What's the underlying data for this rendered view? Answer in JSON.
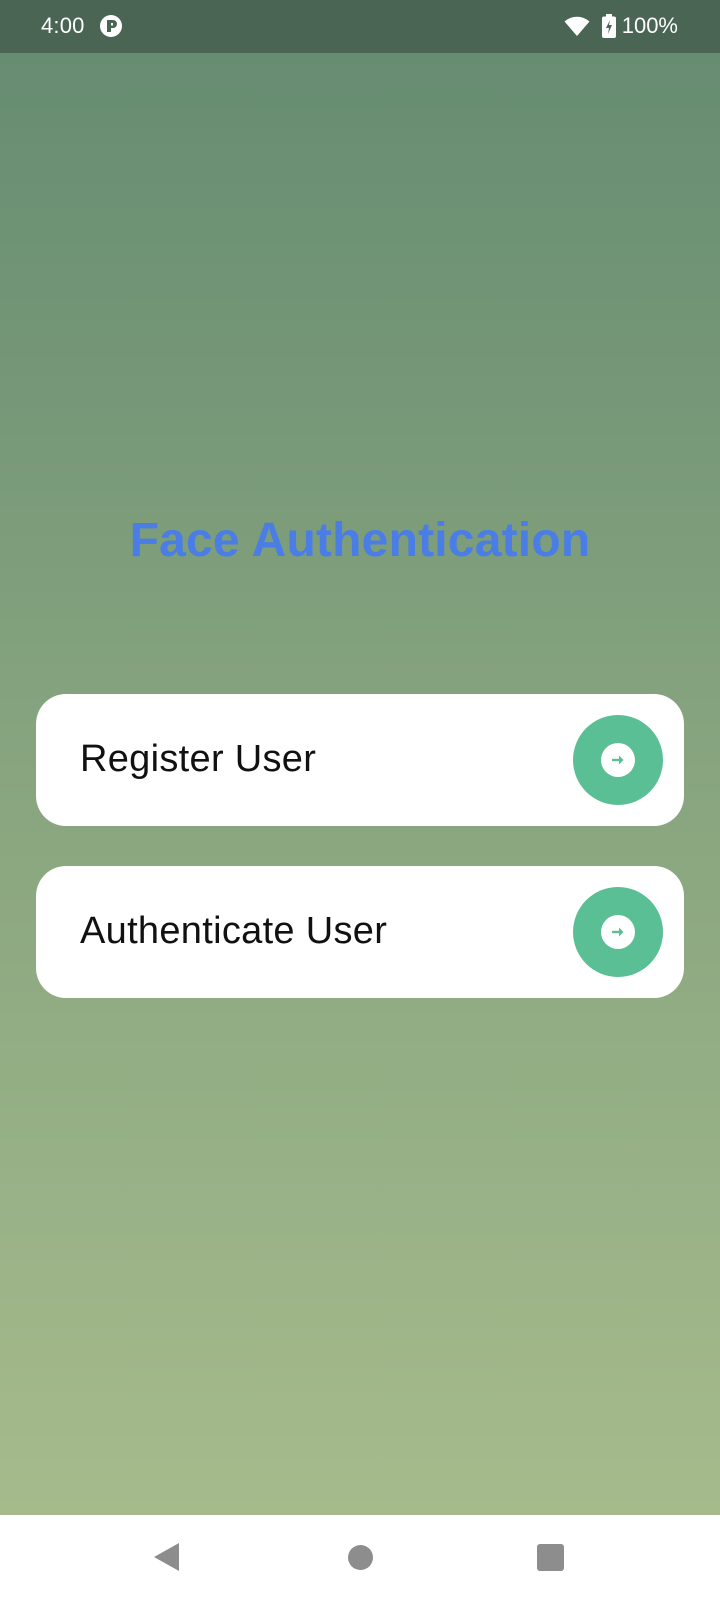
{
  "status_bar": {
    "time": "4:00",
    "battery": "100%",
    "icons": [
      "app-notification-icon",
      "wifi-icon",
      "battery-charging-icon"
    ]
  },
  "main": {
    "title": "Face Authentication",
    "title_color": "#4a7de6",
    "cards": [
      {
        "label": "Register User",
        "action_icon": "arrow-right-circle-icon"
      },
      {
        "label": "Authenticate User",
        "action_icon": "arrow-right-circle-icon"
      }
    ],
    "accent_color": "#5bbf96"
  },
  "nav_bar": {
    "buttons": [
      "back-icon",
      "home-icon",
      "recents-icon"
    ]
  }
}
